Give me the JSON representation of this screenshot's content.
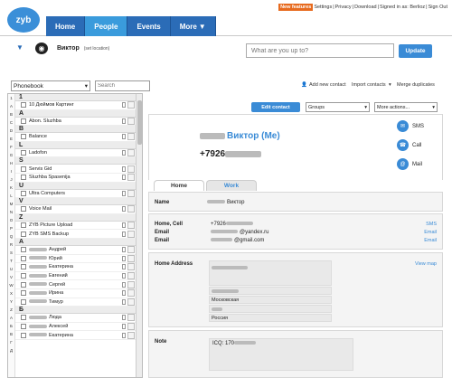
{
  "header": {
    "logo": "zyb",
    "nav_tabs": [
      "Home",
      "People",
      "Events",
      "More"
    ],
    "util_links": [
      "New features",
      "Settings",
      "Privacy",
      "Download",
      "Signed in as: Berlioz",
      "Sign Out"
    ]
  },
  "status": {
    "name": "Виктор",
    "location": "(set location)",
    "input_placeholder": "What are you up to?",
    "update_label": "Update"
  },
  "toolbar": {
    "phonebook": "Phonebook",
    "search_placeholder": "Search",
    "add_contact": "Add new contact",
    "import_contacts": "Import contacts",
    "merge_duplicates": "Merge duplicates"
  },
  "letters": [
    "1",
    "A",
    "B",
    "C",
    "D",
    "E",
    "F",
    "G",
    "H",
    "I",
    "J",
    "K",
    "L",
    "M",
    "N",
    "O",
    "P",
    "Q",
    "R",
    "S",
    "T",
    "U",
    "V",
    "W",
    "X",
    "Y",
    "Z",
    "А",
    "Б",
    "В",
    "Г",
    "Д"
  ],
  "rows": [
    {
      "type": "header",
      "text": "1"
    },
    {
      "type": "contact",
      "text": "10 Дюймов Картинг"
    },
    {
      "type": "header",
      "text": "A"
    },
    {
      "type": "contact",
      "text": "Abon. Sluzhba"
    },
    {
      "type": "header",
      "text": "B"
    },
    {
      "type": "contact",
      "text": "Balance"
    },
    {
      "type": "header",
      "text": "L"
    },
    {
      "type": "contact",
      "text": "Ladofon"
    },
    {
      "type": "header",
      "text": "S"
    },
    {
      "type": "contact",
      "text": "Servis Gid"
    },
    {
      "type": "contact",
      "text": "Sluzhba Spasenija"
    },
    {
      "type": "header",
      "text": "U"
    },
    {
      "type": "contact",
      "text": "Ultra Computers"
    },
    {
      "type": "header",
      "text": "V"
    },
    {
      "type": "contact",
      "text": "Voice Mail"
    },
    {
      "type": "header",
      "text": "Z"
    },
    {
      "type": "contact",
      "text": "ZYB Picture Upload"
    },
    {
      "type": "contact",
      "text": "ZYB SMS Backup"
    },
    {
      "type": "header",
      "text": "А"
    },
    {
      "type": "contact",
      "text": "Андрей"
    },
    {
      "type": "contact",
      "text": "Юрий"
    },
    {
      "type": "contact",
      "text": "Екатерина"
    },
    {
      "type": "contact",
      "text": "Евгений"
    },
    {
      "type": "contact",
      "text": "Сергей"
    },
    {
      "type": "contact",
      "text": "Ирина"
    },
    {
      "type": "contact",
      "text": "Тимур"
    },
    {
      "type": "header",
      "text": "Б"
    },
    {
      "type": "contact",
      "text": "Люда"
    },
    {
      "type": "contact",
      "text": "Алексей"
    },
    {
      "type": "contact",
      "text": "Екатерина"
    }
  ],
  "detail": {
    "edit_label": "Edit contact",
    "groups_label": "Groups",
    "more_actions": "More actions...",
    "contact_name": "Виктор (Me)",
    "contact_phone": "+7926",
    "actions": [
      "SMS",
      "Call",
      "Mail"
    ],
    "tabs": [
      "Home",
      "Work"
    ],
    "name_label": "Name",
    "name_value": "Виктор",
    "home_cell_label": "Home, Cell",
    "home_cell_value": "+7926",
    "email1_label": "Email",
    "email1_value": "@yandex.ru",
    "email2_label": "Email",
    "email2_value": "@gmail.com",
    "sms_link": "SMS",
    "email_link": "Email",
    "address_label": "Home Address",
    "address_lines": [
      "",
      "",
      "Московская",
      "",
      "Россия"
    ],
    "view_map": "View map",
    "note_label": "Note",
    "note_value": "ICQ: 170"
  }
}
